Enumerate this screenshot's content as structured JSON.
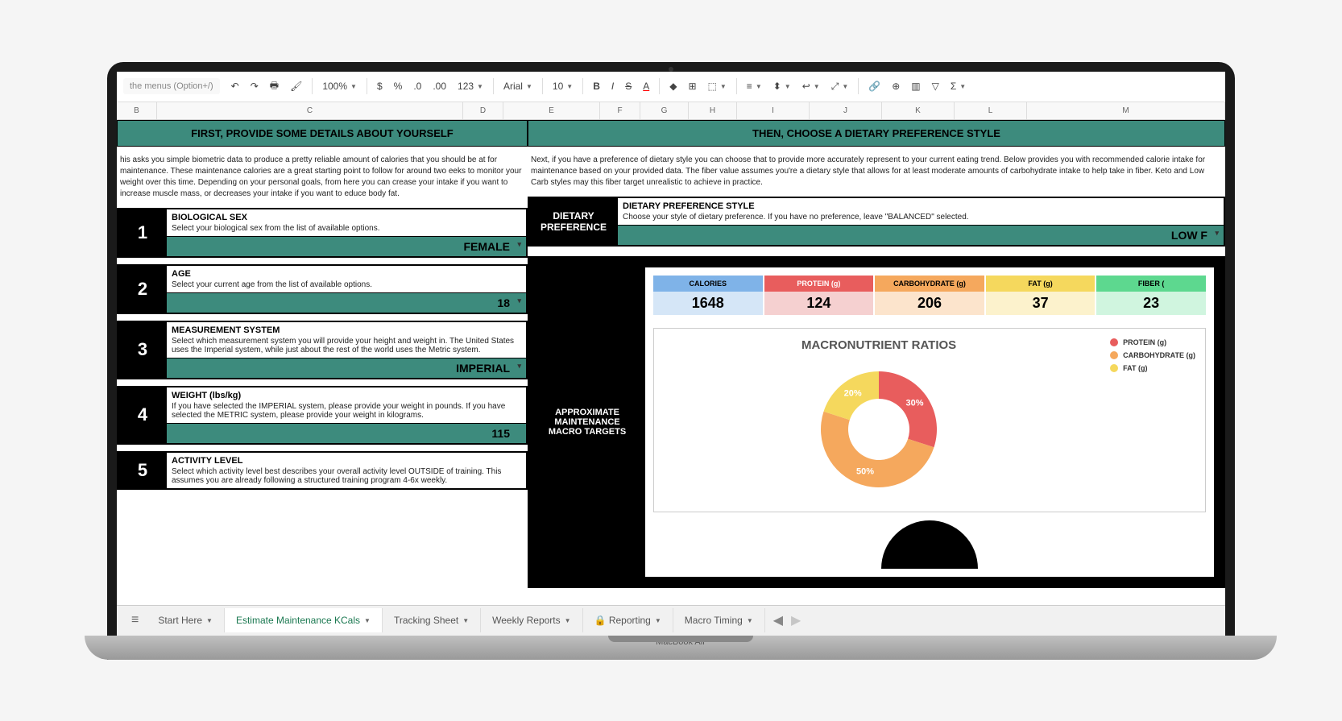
{
  "toolbar": {
    "search_placeholder": "the menus (Option+/)",
    "zoom": "100%",
    "font": "Arial",
    "font_size": "10"
  },
  "columns": [
    "B",
    "C",
    "D",
    "E",
    "F",
    "G",
    "H",
    "I",
    "J",
    "K",
    "L",
    "M"
  ],
  "left": {
    "header": "FIRST, PROVIDE SOME DETAILS ABOUT YOURSELF",
    "intro": "his asks you simple biometric data to produce a pretty reliable amount of calories that you should be at for maintenance. These maintenance calories are a great starting point to follow for around two eeks to monitor your weight over this time. Depending on your personal goals, from here you can crease your intake if you want to increase muscle mass, or decreases your intake if you want to educe body fat.",
    "rows": [
      {
        "num": "1",
        "title": "BIOLOGICAL SEX",
        "desc": "Select your biological sex from the list of available options.",
        "value": "FEMALE"
      },
      {
        "num": "2",
        "title": "AGE",
        "desc": "Select your current age from the list of available options.",
        "value": "18"
      },
      {
        "num": "3",
        "title": "MEASUREMENT SYSTEM",
        "desc": "Select which measurement system you will provide your height and weight in. The United States uses the Imperial system, while just about the rest of the world uses the Metric system.",
        "value": "IMPERIAL"
      },
      {
        "num": "4",
        "title": "WEIGHT (lbs/kg)",
        "desc": "If you have selected the IMPERIAL system, please provide your weight in pounds. If you have selected the METRIC system, please provide your weight in kilograms.",
        "value": "115"
      },
      {
        "num": "5",
        "title": "ACTIVITY LEVEL",
        "desc": "Select which activity level best describes your overall activity level OUTSIDE of training. This assumes you are already following a structured training program 4-6x weekly.",
        "value": ""
      }
    ]
  },
  "right": {
    "header": "THEN, CHOOSE A DIETARY PREFERENCE STYLE",
    "intro": "Next, if you have a preference of dietary style you can choose that to provide more accurately represent to your current eating trend. Below provides you with recommended calorie intake for maintenance based on your provided data. The fiber value assumes you're a dietary style that allows for at least moderate amounts of carbohydrate intake to help take in fiber. Keto and Low Carb styles may this fiber target unrealistic to achieve in practice.",
    "pref_label": "DIETARY PREFERENCE",
    "pref_title": "DIETARY PREFERENCE STYLE",
    "pref_desc": "Choose your style of dietary preference. If you have no preference, leave \"BALANCED\" selected.",
    "pref_value": "LOW F",
    "macro_label": "APPROXIMATE MAINTENANCE MACRO TARGETS",
    "macros": [
      {
        "label": "CALORIES",
        "value": "1648",
        "cls": "c-cal"
      },
      {
        "label": "PROTEIN (g)",
        "value": "124",
        "cls": "c-pro"
      },
      {
        "label": "CARBOHYDRATE (g)",
        "value": "206",
        "cls": "c-carb"
      },
      {
        "label": "FAT (g)",
        "value": "37",
        "cls": "c-fat"
      },
      {
        "label": "FIBER (",
        "value": "23",
        "cls": "c-fib"
      }
    ]
  },
  "chart_data": {
    "type": "pie",
    "title": "MACRONUTRIENT RATIOS",
    "series": [
      {
        "name": "PROTEIN (g)",
        "value": 30,
        "color": "#e85d5d"
      },
      {
        "name": "CARBOHYDRATE (g)",
        "value": 50,
        "color": "#f5a85d"
      },
      {
        "name": "FAT (g)",
        "value": 20,
        "color": "#f5d85d"
      }
    ]
  },
  "tabs": {
    "items": [
      "Start Here",
      "Estimate Maintenance KCals",
      "Tracking Sheet",
      "Weekly Reports",
      "Reporting",
      "Macro Timing"
    ],
    "active": 1,
    "locked_index": 4
  },
  "laptop": "MacBook Air"
}
